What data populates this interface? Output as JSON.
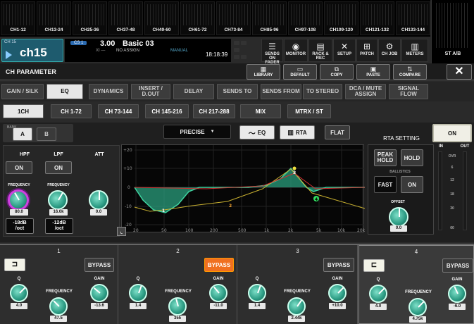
{
  "meters": {
    "groups": [
      "CH1-12",
      "CH13-24",
      "CH25-36",
      "CH37-48",
      "CH49-60",
      "CH61-72",
      "CH73-84",
      "CH85-96",
      "CH97-108",
      "CH109-120",
      "CH121-132",
      "CH133-144"
    ],
    "stereo_label": "ST A/B"
  },
  "channel": {
    "number": "CH 15",
    "name": "ch15"
  },
  "scene": {
    "cs_badge": "CS 1",
    "number": "3.00",
    "name": "Basic 03",
    "xi_label": "XI —",
    "assign": "NO ASSIGN",
    "mode": "MANUAL",
    "time": "18:18:39"
  },
  "toolbar": [
    {
      "icon": "☰",
      "label": "SENDS ON FADER"
    },
    {
      "icon": "◉",
      "label": "MONITOR"
    },
    {
      "icon": "▤",
      "label": "RACK & REC"
    },
    {
      "icon": "✕",
      "label": "SETUP"
    },
    {
      "icon": "⊞",
      "label": "PATCH"
    },
    {
      "icon": "⚙",
      "label": "CH JOB"
    },
    {
      "icon": "▥",
      "label": "METERS"
    }
  ],
  "header": {
    "title": "CH PARAMETER",
    "buttons": [
      {
        "icon": "▦",
        "label": "LIBRARY"
      },
      {
        "icon": "▭",
        "label": "DEFAULT"
      },
      {
        "icon": "⧉",
        "label": "COPY"
      },
      {
        "icon": "▣",
        "label": "PASTE"
      },
      {
        "icon": "⇅",
        "label": "COMPARE"
      }
    ],
    "close": "✕"
  },
  "tabs": [
    {
      "label": "GAIN / SILK"
    },
    {
      "label": "EQ"
    },
    {
      "label": "DYNAMICS"
    },
    {
      "label": "INSERT / D.OUT"
    },
    {
      "label": "DELAY"
    },
    {
      "label": "SENDS TO"
    },
    {
      "label": "SENDS FROM"
    },
    {
      "label": "TO STEREO"
    },
    {
      "label": "DCA / MUTE ASSIGN"
    },
    {
      "label": "SIGNAL FLOW"
    }
  ],
  "subtabs": [
    {
      "label": "1CH"
    },
    {
      "label": "CH 1-72"
    },
    {
      "label": "CH 73-144"
    },
    {
      "label": "CH 145-216"
    },
    {
      "label": "CH 217-288"
    },
    {
      "label": "MIX"
    },
    {
      "label": "MTRX / ST"
    }
  ],
  "bank": {
    "label": "BANK",
    "a": "A",
    "b": "B"
  },
  "filters": {
    "hpf": {
      "label": "HPF",
      "on": "ON",
      "freq_label": "FREQUENCY",
      "freq": "80.0",
      "slope": "-18dB\n/oct"
    },
    "lpf": {
      "label": "LPF",
      "on": "ON",
      "freq_label": "FREQUENCY",
      "freq": "16.0k",
      "slope": "-12dB\n/oct"
    },
    "att": {
      "label": "ATT",
      "value": "0.0"
    }
  },
  "eq": {
    "type": "PRECISE",
    "eq_btn": "EQ",
    "rta_btn": "RTA",
    "flat": "FLAT",
    "on": "ON"
  },
  "graph": {
    "y_ticks": [
      "+20",
      "+10",
      "0",
      "-10",
      "-20"
    ],
    "x_ticks": [
      "20",
      "50",
      "100",
      "200",
      "500",
      "1k",
      "2k",
      "5k",
      "10k",
      "20k"
    ],
    "markers": [
      "1",
      "2",
      "3",
      "4"
    ]
  },
  "rta": {
    "title": "RTA SETTING",
    "peak_hold": "PEAK HOLD",
    "hold": "HOLD",
    "ballistics": "BALLISTICS",
    "fast": "FAST",
    "on": "ON",
    "offset_label": "OFFSET",
    "offset": "0.0"
  },
  "level_meter": {
    "in": "IN",
    "out": "OUT",
    "ovr": "OVR",
    "scale": [
      "6",
      "12",
      "18",
      "30",
      "60"
    ]
  },
  "bands": [
    {
      "num": "1",
      "bypass": "BYPASS",
      "q_label": "Q",
      "q": "4.0",
      "freq_label": "FREQUENCY",
      "freq": "47.5",
      "gain_label": "GAIN",
      "gain": "-13.6"
    },
    {
      "num": "2",
      "bypass": "BYPASS",
      "q_label": "Q",
      "q": "1.4",
      "freq_label": "FREQUENCY",
      "freq": "355",
      "gain_label": "GAIN",
      "gain": "-11.0"
    },
    {
      "num": "3",
      "bypass": "BYPASS",
      "q_label": "Q",
      "q": "1.4",
      "freq_label": "FREQUENCY",
      "freq": "2.44k",
      "gain_label": "GAIN",
      "gain": "+10.0"
    },
    {
      "num": "4",
      "bypass": "BYPASS",
      "q_label": "Q",
      "q": "4.0",
      "freq_label": "FREQUENCY",
      "freq": "4.75k",
      "gain_label": "GAIN",
      "gain": "-6.0"
    }
  ],
  "colors": {
    "accent": "#2aa88a",
    "bypass_active": "#f07020",
    "eq_curve": "#3fd3a0",
    "peak": "#d040e0"
  }
}
